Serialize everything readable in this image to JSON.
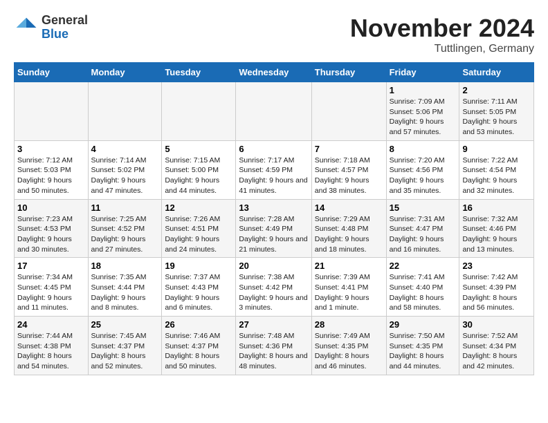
{
  "header": {
    "logo_line1": "General",
    "logo_line2": "Blue",
    "month": "November 2024",
    "location": "Tuttlingen, Germany"
  },
  "days_of_week": [
    "Sunday",
    "Monday",
    "Tuesday",
    "Wednesday",
    "Thursday",
    "Friday",
    "Saturday"
  ],
  "weeks": [
    [
      {
        "day": "",
        "info": ""
      },
      {
        "day": "",
        "info": ""
      },
      {
        "day": "",
        "info": ""
      },
      {
        "day": "",
        "info": ""
      },
      {
        "day": "",
        "info": ""
      },
      {
        "day": "1",
        "info": "Sunrise: 7:09 AM\nSunset: 5:06 PM\nDaylight: 9 hours and 57 minutes."
      },
      {
        "day": "2",
        "info": "Sunrise: 7:11 AM\nSunset: 5:05 PM\nDaylight: 9 hours and 53 minutes."
      }
    ],
    [
      {
        "day": "3",
        "info": "Sunrise: 7:12 AM\nSunset: 5:03 PM\nDaylight: 9 hours and 50 minutes."
      },
      {
        "day": "4",
        "info": "Sunrise: 7:14 AM\nSunset: 5:02 PM\nDaylight: 9 hours and 47 minutes."
      },
      {
        "day": "5",
        "info": "Sunrise: 7:15 AM\nSunset: 5:00 PM\nDaylight: 9 hours and 44 minutes."
      },
      {
        "day": "6",
        "info": "Sunrise: 7:17 AM\nSunset: 4:59 PM\nDaylight: 9 hours and 41 minutes."
      },
      {
        "day": "7",
        "info": "Sunrise: 7:18 AM\nSunset: 4:57 PM\nDaylight: 9 hours and 38 minutes."
      },
      {
        "day": "8",
        "info": "Sunrise: 7:20 AM\nSunset: 4:56 PM\nDaylight: 9 hours and 35 minutes."
      },
      {
        "day": "9",
        "info": "Sunrise: 7:22 AM\nSunset: 4:54 PM\nDaylight: 9 hours and 32 minutes."
      }
    ],
    [
      {
        "day": "10",
        "info": "Sunrise: 7:23 AM\nSunset: 4:53 PM\nDaylight: 9 hours and 30 minutes."
      },
      {
        "day": "11",
        "info": "Sunrise: 7:25 AM\nSunset: 4:52 PM\nDaylight: 9 hours and 27 minutes."
      },
      {
        "day": "12",
        "info": "Sunrise: 7:26 AM\nSunset: 4:51 PM\nDaylight: 9 hours and 24 minutes."
      },
      {
        "day": "13",
        "info": "Sunrise: 7:28 AM\nSunset: 4:49 PM\nDaylight: 9 hours and 21 minutes."
      },
      {
        "day": "14",
        "info": "Sunrise: 7:29 AM\nSunset: 4:48 PM\nDaylight: 9 hours and 18 minutes."
      },
      {
        "day": "15",
        "info": "Sunrise: 7:31 AM\nSunset: 4:47 PM\nDaylight: 9 hours and 16 minutes."
      },
      {
        "day": "16",
        "info": "Sunrise: 7:32 AM\nSunset: 4:46 PM\nDaylight: 9 hours and 13 minutes."
      }
    ],
    [
      {
        "day": "17",
        "info": "Sunrise: 7:34 AM\nSunset: 4:45 PM\nDaylight: 9 hours and 11 minutes."
      },
      {
        "day": "18",
        "info": "Sunrise: 7:35 AM\nSunset: 4:44 PM\nDaylight: 9 hours and 8 minutes."
      },
      {
        "day": "19",
        "info": "Sunrise: 7:37 AM\nSunset: 4:43 PM\nDaylight: 9 hours and 6 minutes."
      },
      {
        "day": "20",
        "info": "Sunrise: 7:38 AM\nSunset: 4:42 PM\nDaylight: 9 hours and 3 minutes."
      },
      {
        "day": "21",
        "info": "Sunrise: 7:39 AM\nSunset: 4:41 PM\nDaylight: 9 hours and 1 minute."
      },
      {
        "day": "22",
        "info": "Sunrise: 7:41 AM\nSunset: 4:40 PM\nDaylight: 8 hours and 58 minutes."
      },
      {
        "day": "23",
        "info": "Sunrise: 7:42 AM\nSunset: 4:39 PM\nDaylight: 8 hours and 56 minutes."
      }
    ],
    [
      {
        "day": "24",
        "info": "Sunrise: 7:44 AM\nSunset: 4:38 PM\nDaylight: 8 hours and 54 minutes."
      },
      {
        "day": "25",
        "info": "Sunrise: 7:45 AM\nSunset: 4:37 PM\nDaylight: 8 hours and 52 minutes."
      },
      {
        "day": "26",
        "info": "Sunrise: 7:46 AM\nSunset: 4:37 PM\nDaylight: 8 hours and 50 minutes."
      },
      {
        "day": "27",
        "info": "Sunrise: 7:48 AM\nSunset: 4:36 PM\nDaylight: 8 hours and 48 minutes."
      },
      {
        "day": "28",
        "info": "Sunrise: 7:49 AM\nSunset: 4:35 PM\nDaylight: 8 hours and 46 minutes."
      },
      {
        "day": "29",
        "info": "Sunrise: 7:50 AM\nSunset: 4:35 PM\nDaylight: 8 hours and 44 minutes."
      },
      {
        "day": "30",
        "info": "Sunrise: 7:52 AM\nSunset: 4:34 PM\nDaylight: 8 hours and 42 minutes."
      }
    ]
  ]
}
